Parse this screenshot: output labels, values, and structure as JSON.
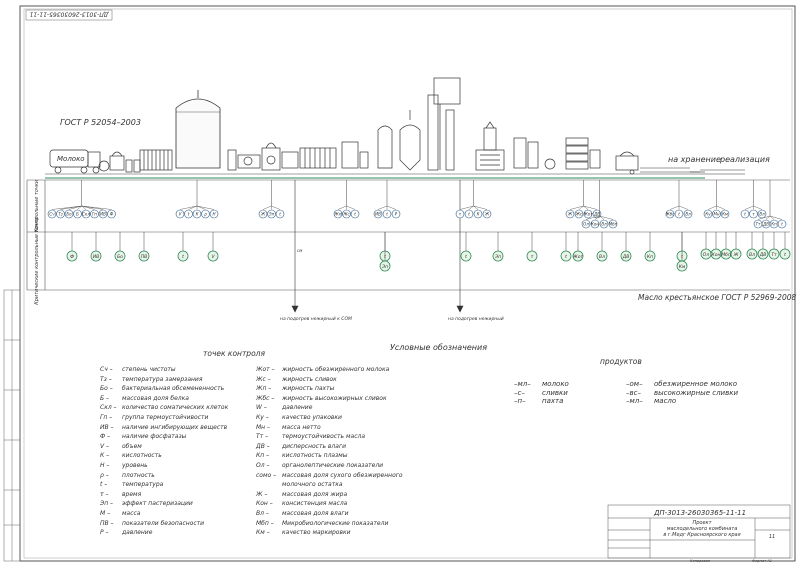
{
  "stamp_top": "ДП-3013-26030365-11-11",
  "standard_main": "ГОСТ Р 52054–2003",
  "standard_butter": "Масло крестьянское ГОСТ Р 52969-2008",
  "milk_label": "Молоко",
  "storage_label": "на хранение",
  "sale_label": "реализация",
  "row_labels": {
    "control": "Контрольные точки",
    "critical": "Критические контрольные точки"
  },
  "arrow_cm": "см",
  "arrow_left_text": "на подогрев нежирный к СОМ",
  "arrow_right_text": "на подогрев нежирный",
  "legend_title": "Условные обозначения",
  "control_points_title": "точек контроля",
  "products_title": "продуктов",
  "legend_left": [
    {
      "code": "Сч –",
      "text": "степень чистоты"
    },
    {
      "code": "Тз –",
      "text": "температура замерзания"
    },
    {
      "code": "Бо –",
      "text": "бактериальная обсемененность"
    },
    {
      "code": "Б –",
      "text": "массовая доля белка"
    },
    {
      "code": "Скл –",
      "text": "количество соматических клеток"
    },
    {
      "code": "Гп –",
      "text": "группа термоустойчивости"
    },
    {
      "code": "ИВ –",
      "text": "наличие ингибирующих веществ"
    },
    {
      "code": "Ф –",
      "text": "наличие фосфатазы"
    },
    {
      "code": "V –",
      "text": "объем"
    },
    {
      "code": "К –",
      "text": "кислотность"
    },
    {
      "code": "Н –",
      "text": "уровень"
    },
    {
      "code": "ρ –",
      "text": "плотность"
    },
    {
      "code": "t –",
      "text": "температура"
    },
    {
      "code": "τ –",
      "text": "время"
    },
    {
      "code": "Эп –",
      "text": "эффект пастеризации"
    },
    {
      "code": "М –",
      "text": "масса"
    },
    {
      "code": "ПВ –",
      "text": "показатели безопасности"
    },
    {
      "code": "Р –",
      "text": "давление"
    }
  ],
  "legend_mid": [
    {
      "code": "Жот –",
      "text": "жирность обезжиренного молока"
    },
    {
      "code": "Жс –",
      "text": "жирность сливок"
    },
    {
      "code": "Жп –",
      "text": "жирность пахты"
    },
    {
      "code": "Жбс –",
      "text": "жирность высокожирных сливок"
    },
    {
      "code": "W –",
      "text": "давление"
    },
    {
      "code": "Ку –",
      "text": "качество упаковки"
    },
    {
      "code": "Мн –",
      "text": "масса нетто"
    },
    {
      "code": "Тт –",
      "text": "термоустойчивость масла"
    },
    {
      "code": "ДВ –",
      "text": "дисперсность влаги"
    },
    {
      "code": "Кп –",
      "text": "кислотность плазмы"
    },
    {
      "code": "Ол –",
      "text": "органолептические показатели"
    },
    {
      "code": "сомо –",
      "text": "массовая доля сухого обезжиренного"
    },
    {
      "code": "",
      "text": "молочного остатка"
    },
    {
      "code": "Ж –",
      "text": "массовая доля жира"
    },
    {
      "code": "Кон –",
      "text": "консистенция масла"
    },
    {
      "code": "Вл –",
      "text": "массовая доля влаги"
    },
    {
      "code": "Мбп –",
      "text": "Микробиологические показатели"
    },
    {
      "code": "Км –",
      "text": "качество маркировки"
    }
  ],
  "legend_products": [
    {
      "code": "–мл–",
      "text": "молоко"
    },
    {
      "code": "–с–",
      "text": "сливки"
    },
    {
      "code": "–п–",
      "text": "пахта"
    },
    {
      "code": "–ом–",
      "text": "обезжиренное молоко"
    },
    {
      "code": "–вс–",
      "text": "высокожирные сливки"
    },
    {
      "code": "–мл–",
      "text": "масло"
    }
  ],
  "title_block": {
    "code": "ДП-3013-26030365-11-11",
    "project_line1": "Проект",
    "project_line2": "маслодельного комбината",
    "project_line3": "в г.Медг Красноярского края",
    "sheet_count": "11",
    "footer": "Копировал",
    "format": "Формат А1"
  },
  "control_codes": {
    "g1": [
      "Сч",
      "Тз",
      "Бо",
      "Б",
      "Скл",
      "Гп",
      "ИВ",
      "Ф"
    ],
    "g2": [
      "V",
      "t",
      "К",
      "ρ",
      "Н"
    ],
    "g3": [
      "Ж",
      "Эп",
      "t"
    ],
    "g4": [
      "Жп",
      "Жс",
      "t"
    ],
    "g5": [
      "ИВ",
      "t",
      "Р"
    ],
    "g6": [
      "τ",
      "t",
      "К",
      "Ж"
    ],
    "g7": [
      "Ж",
      "Жс",
      "Жот",
      "ДВ"
    ],
    "g8": [
      "Жбс",
      "t",
      "Вл"
    ],
    "g9": [
      "Ку",
      "Мн",
      "Км"
    ],
    "g10": [
      "t",
      "τ",
      "Вл"
    ],
    "g11": [
      "Ол",
      "Кон",
      "Вл",
      "Мбп"
    ],
    "g12": [
      "Тт",
      "ДВ",
      "Кп",
      "t"
    ]
  },
  "critical_codes": {
    "c1": [
      "Ф",
      "ИВ",
      "Бо",
      "ПВ"
    ],
    "c2": [
      "t",
      "V"
    ],
    "c3": [
      "t",
      "Эп"
    ],
    "c4": [
      "t"
    ],
    "c5": [
      "Эп",
      "τ",
      "t"
    ],
    "c6": [
      "Жот",
      "Вл",
      "ДВ",
      "Кп"
    ],
    "c7": [
      "t",
      "Км"
    ],
    "c8": [
      "Ол",
      "Кон",
      "Мбп",
      "Ж"
    ],
    "c9": [
      "Вл",
      "ДВ",
      "Тт",
      "t"
    ]
  }
}
